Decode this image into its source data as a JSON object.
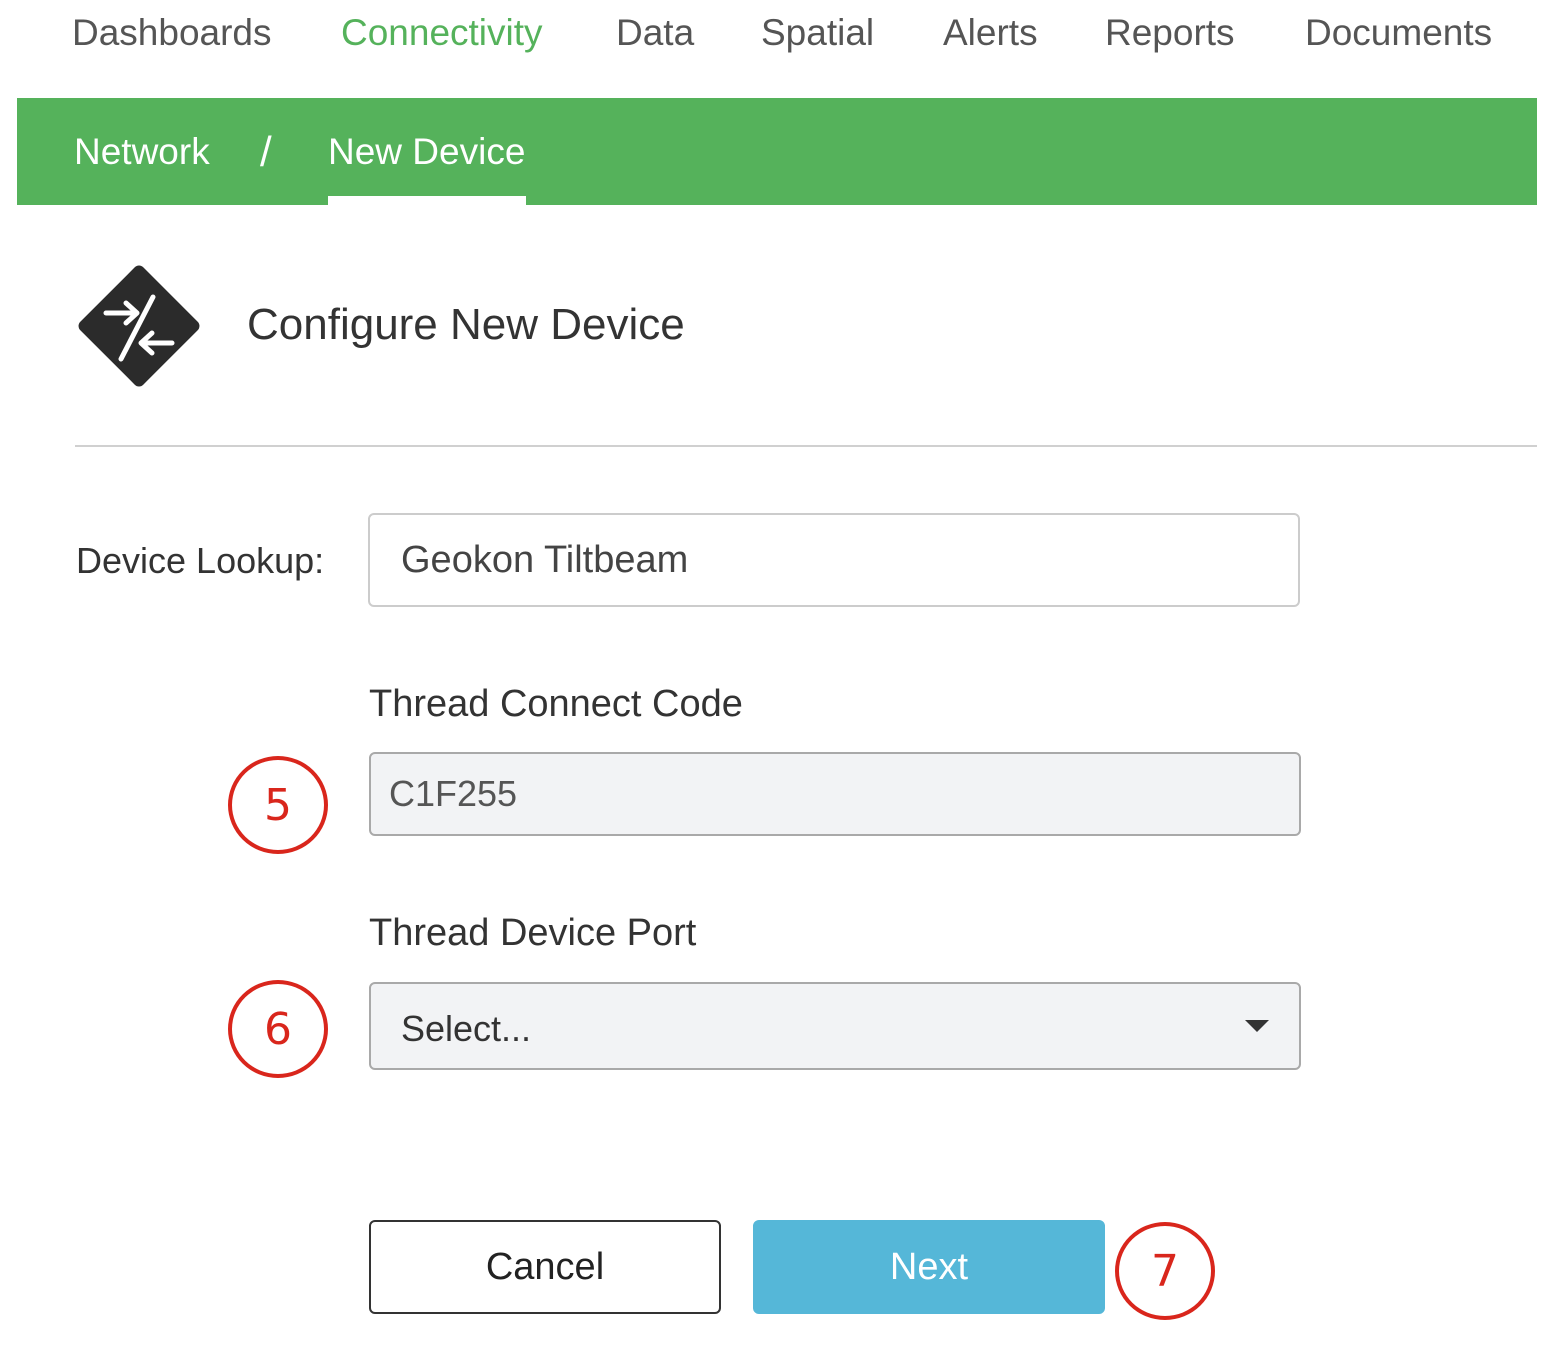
{
  "top_nav": {
    "items": [
      {
        "label": "Dashboards",
        "active": false
      },
      {
        "label": "Connectivity",
        "active": true
      },
      {
        "label": "Data",
        "active": false
      },
      {
        "label": "Spatial",
        "active": false
      },
      {
        "label": "Alerts",
        "active": false
      },
      {
        "label": "Reports",
        "active": false
      },
      {
        "label": "Documents",
        "active": false
      }
    ]
  },
  "breadcrumb": {
    "network": "Network",
    "separator": "/",
    "current": "New Device"
  },
  "header": {
    "icon": "connection-arrows-icon",
    "title": "Configure New Device"
  },
  "form": {
    "lookup": {
      "label": "Device Lookup:",
      "value": "Geokon Tiltbeam"
    },
    "connect_code": {
      "label": "Thread Connect Code",
      "value": "C1F255"
    },
    "device_port": {
      "label": "Thread Device Port",
      "selected": "Select..."
    }
  },
  "buttons": {
    "cancel": "Cancel",
    "next": "Next"
  },
  "callouts": {
    "c5": "5",
    "c6": "6",
    "c7": "7"
  },
  "colors": {
    "accent_green": "#55b25b",
    "next_blue": "#55b7d8",
    "callout_red": "#d9261c"
  }
}
